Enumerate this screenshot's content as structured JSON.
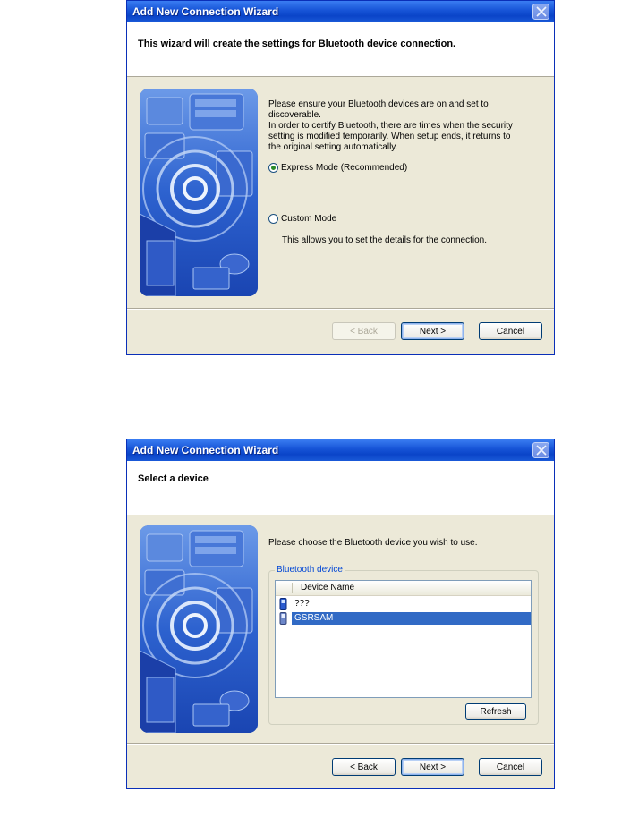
{
  "dialog1": {
    "title": "Add New Connection Wizard",
    "header": "This wizard will create the settings for Bluetooth device connection.",
    "intro_lines": [
      "Please ensure your Bluetooth devices are on and set to",
      "discoverable.",
      "In order to certify Bluetooth, there are times when the security",
      "setting is modified temporarily. When setup ends, it returns to",
      "the original setting automatically."
    ],
    "express_mode": {
      "label": "Express Mode (Recommended)",
      "selected": true
    },
    "custom_mode": {
      "label": "Custom Mode",
      "selected": false
    },
    "custom_description": "This allows you to set the details for the connection.",
    "buttons": {
      "back": "< Back",
      "next": "Next >",
      "cancel": "Cancel"
    }
  },
  "dialog2": {
    "title": "Add New Connection Wizard",
    "header": "Select a device",
    "instruction": "Please choose the Bluetooth device you wish to use.",
    "group_label": "Bluetooth device",
    "column_header": "Device Name",
    "devices": [
      {
        "name": "???",
        "icon": "phone-icon",
        "selected": false
      },
      {
        "name": "GSRSAM",
        "icon": "phone-icon",
        "selected": true
      }
    ],
    "refresh_label": "Refresh",
    "buttons": {
      "back": "< Back",
      "next": "Next >",
      "cancel": "Cancel"
    }
  },
  "colors": {
    "titlebar": "#0a44c8",
    "dialog_bg": "#ece9d8",
    "selection": "#316ac5",
    "group_label": "#0046d5"
  }
}
